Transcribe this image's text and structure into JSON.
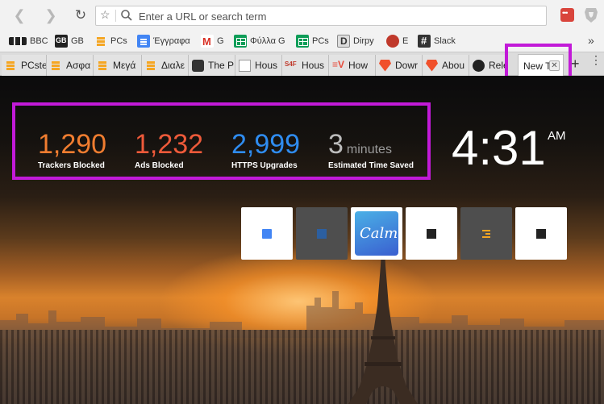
{
  "toolbar": {
    "url_placeholder": "Enter a URL or search term"
  },
  "bookmarks": [
    {
      "label": "BBC",
      "icon": "bbc-icon"
    },
    {
      "label": "GB",
      "icon": "gb-icon"
    },
    {
      "label": "PCs",
      "icon": "pcs-icon"
    },
    {
      "label": "Έγγραφα",
      "icon": "google-docs-icon"
    },
    {
      "label": "G",
      "icon": "gmail-icon"
    },
    {
      "label": "Φύλλα G",
      "icon": "google-sheets-icon"
    },
    {
      "label": "PCs",
      "icon": "google-sheets-icon"
    },
    {
      "label": "Dirpy",
      "icon": "dirpy-icon"
    },
    {
      "label": "E",
      "icon": "e-icon"
    },
    {
      "label": "Slack",
      "icon": "slack-icon"
    }
  ],
  "tabs": [
    {
      "label": "PCste",
      "icon": "pcs-icon"
    },
    {
      "label": "Ασφα",
      "icon": "pcs-icon"
    },
    {
      "label": "Μεγά",
      "icon": "pcs-icon"
    },
    {
      "label": "Διαλε",
      "icon": "pcs-icon"
    },
    {
      "label": "The P",
      "icon": "bus-icon"
    },
    {
      "label": "Hous",
      "icon": "page-icon"
    },
    {
      "label": "Hous",
      "icon": "s4f-icon"
    },
    {
      "label": "How",
      "icon": "ev-icon"
    },
    {
      "label": "Dowr",
      "icon": "brave-icon"
    },
    {
      "label": "Abou",
      "icon": "brave-icon"
    },
    {
      "label": "Relea",
      "icon": "github-icon"
    },
    {
      "label": "New T",
      "icon": "none",
      "active": true
    }
  ],
  "stats": {
    "trackers": {
      "value": "1,290",
      "label": "Trackers Blocked",
      "color": "#f07d30"
    },
    "ads": {
      "value": "1,232",
      "label": "Ads Blocked",
      "color": "#ee5a3a"
    },
    "https": {
      "value": "2,999",
      "label": "HTTPS Upgrades",
      "color": "#2f8cf0"
    },
    "time": {
      "value": "3",
      "unit": "minutes",
      "label": "Estimated Time Saved",
      "color": "#bcbcbc"
    }
  },
  "clock": {
    "time": "4:31",
    "ampm": "AM"
  },
  "tiles": [
    {
      "name": "tile-google-docs",
      "style": "white"
    },
    {
      "name": "tile-dark-site",
      "style": "gray"
    },
    {
      "name": "tile-calm",
      "style": "calm",
      "label": "Calm"
    },
    {
      "name": "tile-gb",
      "style": "white"
    },
    {
      "name": "tile-pcs",
      "style": "gray"
    },
    {
      "name": "tile-gb-2",
      "style": "white"
    }
  ],
  "colors": {
    "highlight": "#c21ad8",
    "brave_orange": "#f0502b"
  }
}
